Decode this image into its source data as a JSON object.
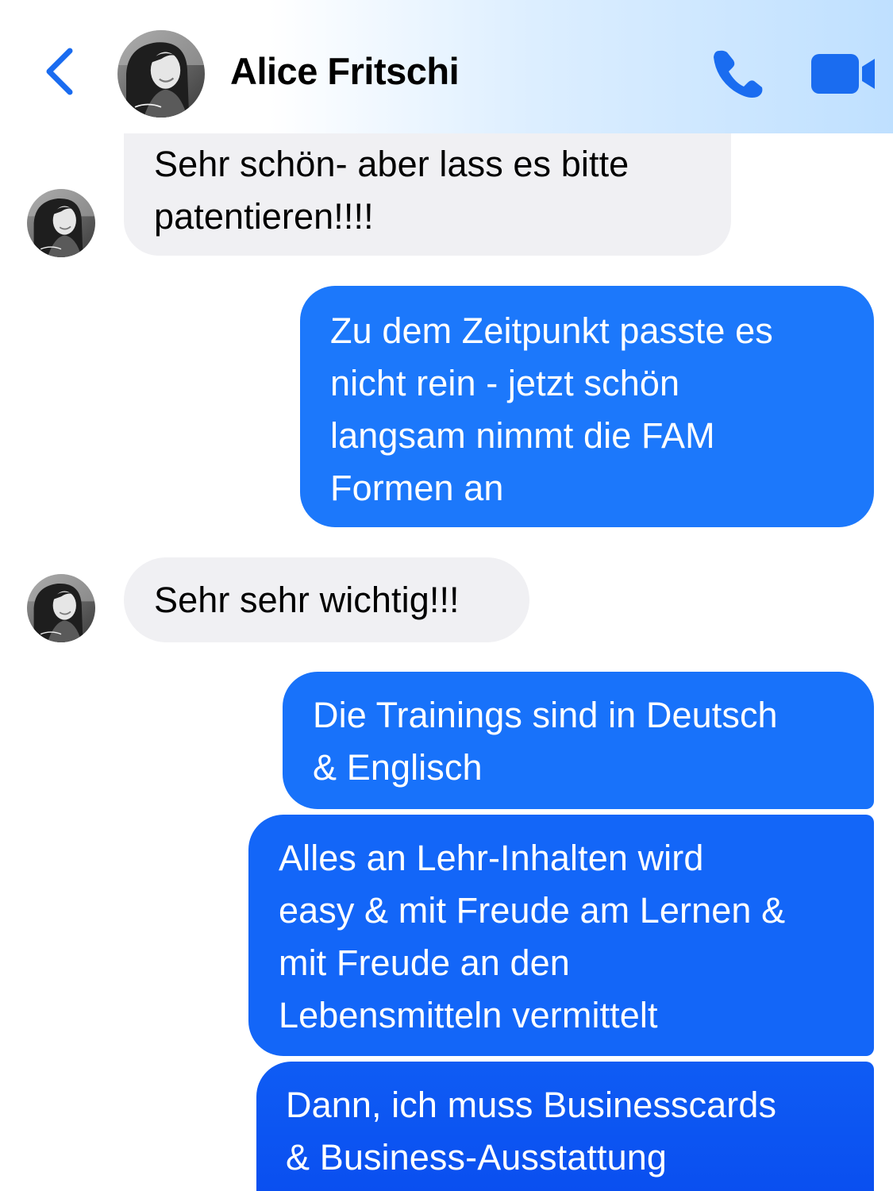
{
  "header": {
    "contact_name": "Alice Fritschi",
    "back_icon": "chevron-left-icon",
    "call_icon": "phone-icon",
    "video_icon": "video-camera-icon",
    "accent_color": "#1a6cf0"
  },
  "messages": [
    {
      "direction": "incoming",
      "text": "Sehr schön- aber lass es bitte\npatentieren!!!!"
    },
    {
      "direction": "outgoing",
      "text": "Zu dem Zeitpunkt passte es\nnicht rein - jetzt schön\nlangsam nimmt die FAM\nFormen an"
    },
    {
      "direction": "incoming",
      "text": "Sehr sehr wichtig!!!"
    },
    {
      "direction": "outgoing",
      "text": "Die Trainings sind in Deutsch\n& Englisch"
    },
    {
      "direction": "outgoing",
      "text": "Alles an Lehr-Inhalten wird\neasy & mit Freude am Lernen &\nmit Freude an den\nLebensmitteln vermittelt"
    },
    {
      "direction": "outgoing",
      "text": "Dann, ich muss Businesscards\n& Business-Ausstattung"
    }
  ],
  "colors": {
    "incoming_bubble": "#f0f0f3",
    "outgoing_bubble_top": "#1c7bfb",
    "outgoing_bubble_bottom": "#0a4ff0"
  }
}
